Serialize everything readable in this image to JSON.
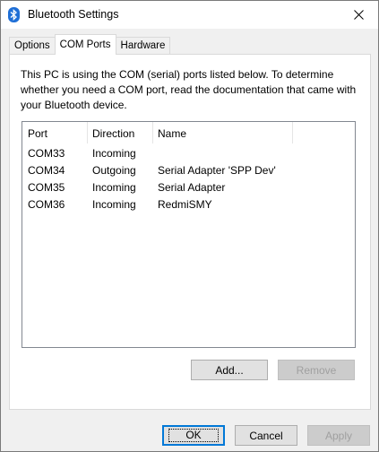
{
  "window": {
    "title": "Bluetooth Settings"
  },
  "tabs": [
    {
      "label": "Options",
      "active": false
    },
    {
      "label": "COM Ports",
      "active": true
    },
    {
      "label": "Hardware",
      "active": false
    }
  ],
  "description": "This PC is using the COM (serial) ports listed below. To determine whether you need a COM port, read the documentation that came with your Bluetooth device.",
  "ports_list": {
    "columns": [
      "Port",
      "Direction",
      "Name"
    ],
    "rows": [
      {
        "port": "COM33",
        "direction": "Incoming",
        "name": ""
      },
      {
        "port": "COM34",
        "direction": "Outgoing",
        "name": "Serial Adapter 'SPP Dev'"
      },
      {
        "port": "COM35",
        "direction": "Incoming",
        "name": "Serial Adapter"
      },
      {
        "port": "COM36",
        "direction": "Incoming",
        "name": "RedmiSMY"
      }
    ]
  },
  "panel_buttons": {
    "add": "Add...",
    "remove": "Remove"
  },
  "dialog_buttons": {
    "ok": "OK",
    "cancel": "Cancel",
    "apply": "Apply"
  },
  "colors": {
    "accent": "#0078d7",
    "bluetooth_icon": "#1f6fd6"
  },
  "icons": {
    "title": "bluetooth-icon",
    "close": "close-icon"
  }
}
